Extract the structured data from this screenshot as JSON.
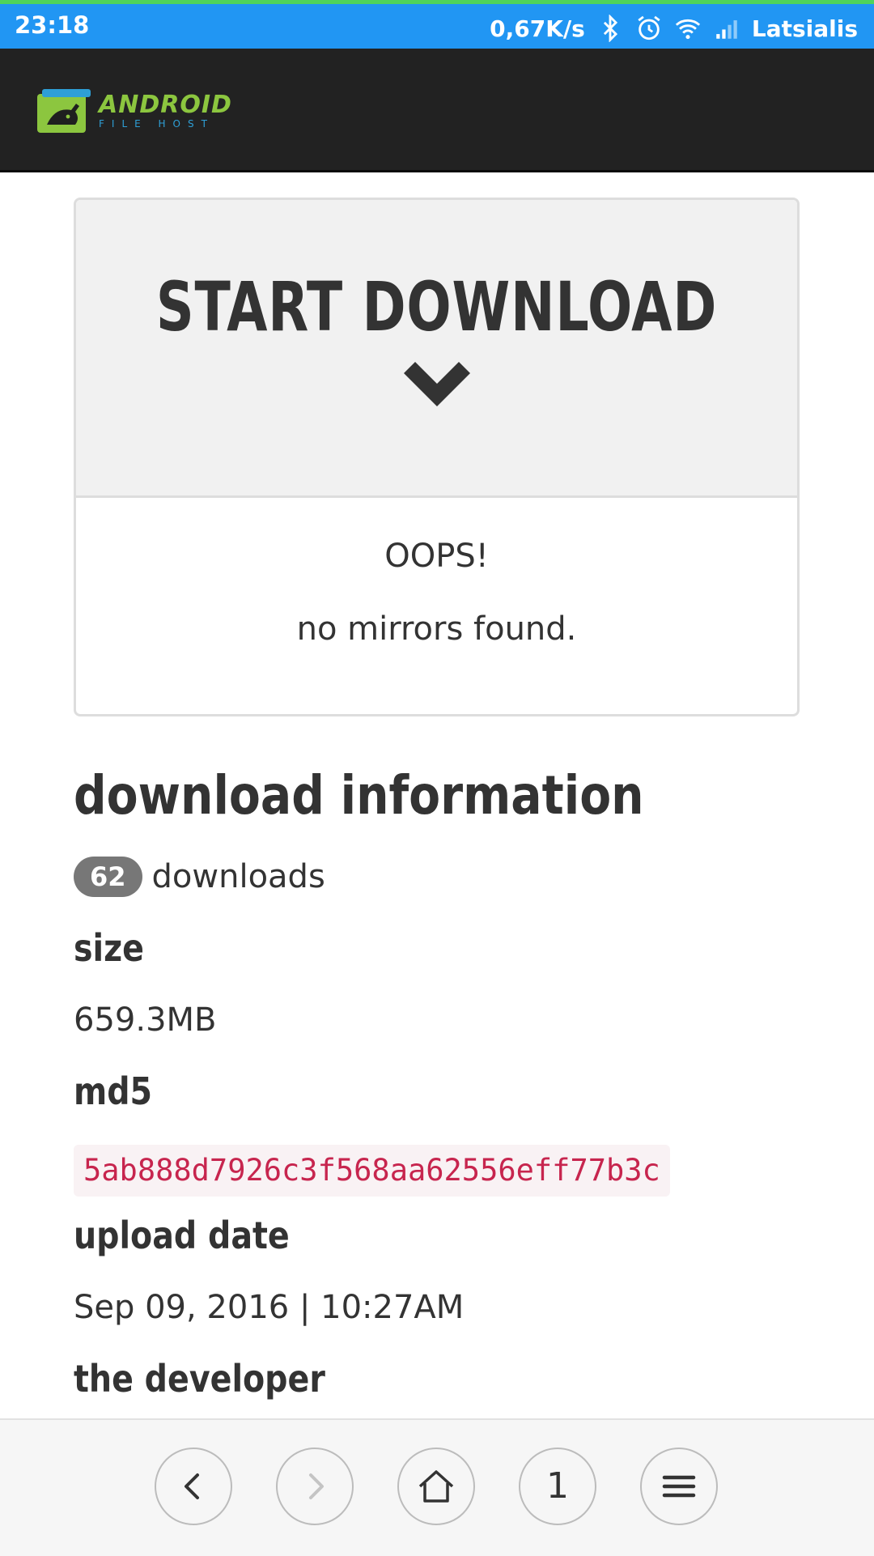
{
  "status_bar": {
    "time": "23:18",
    "speed": "0,67K/s",
    "carrier": "Latsialis",
    "icons": [
      "bluetooth-icon",
      "alarm-icon",
      "wifi-icon",
      "signal-icon"
    ],
    "bar_color": "#2196f3"
  },
  "header": {
    "logo_name": "ANDROID",
    "logo_sub": "FILE HOST",
    "background": "#222222"
  },
  "download_panel": {
    "start_label": "START DOWNLOAD",
    "chevron_icon": "chevron-down-icon",
    "error_title": "OOPS!",
    "error_message": "no mirrors found."
  },
  "info": {
    "heading": "download information",
    "downloads_count": "62",
    "downloads_label": "downloads",
    "size_label": "size",
    "size_value": "659.3MB",
    "md5_label": "md5",
    "md5_value": "5ab888d7926c3f568aa62556eff77b3c",
    "upload_label": "upload date",
    "upload_value": "Sep 09, 2016 | 10:27AM",
    "developer_label": "the developer"
  },
  "bottom_nav": {
    "tab_count": "1",
    "icons": [
      "back-icon",
      "forward-icon",
      "home-icon",
      "tabs-icon",
      "menu-icon"
    ]
  }
}
